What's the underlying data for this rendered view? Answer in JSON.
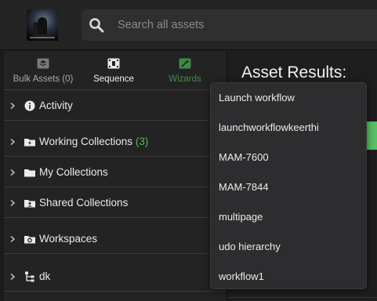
{
  "search": {
    "placeholder": "Search all assets"
  },
  "tabs": [
    {
      "label": "Bulk Assets (0)",
      "icon": "stack-icon"
    },
    {
      "label": "Sequence",
      "icon": "sequence-icon"
    },
    {
      "label": "Wizards",
      "icon": "wand-icon"
    }
  ],
  "tree": [
    {
      "label": "Activity",
      "icon": "info-icon",
      "count": ""
    },
    {
      "label": "Working Collections",
      "icon": "folder-lightning-icon",
      "count": "(3)"
    },
    {
      "label": "My Collections",
      "icon": "folder-icon",
      "count": ""
    },
    {
      "label": "Shared Collections",
      "icon": "shared-folder-icon",
      "count": ""
    },
    {
      "label": "Workspaces",
      "icon": "workspace-folder-icon",
      "count": ""
    },
    {
      "label": "dk",
      "icon": "hierarchy-icon",
      "count": ""
    }
  ],
  "main": {
    "title": "Asset Results:"
  },
  "workflow_menu": {
    "items": [
      "Launch workflow",
      "launchworkflowkeerthi",
      "MAM-7600",
      "MAM-7844",
      "multipage",
      "udo hierarchy",
      "workflow1"
    ]
  },
  "colors": {
    "accent_green": "#4cbb5a",
    "wizards_green": "#3f8a46",
    "background": "#1b1b1b"
  }
}
